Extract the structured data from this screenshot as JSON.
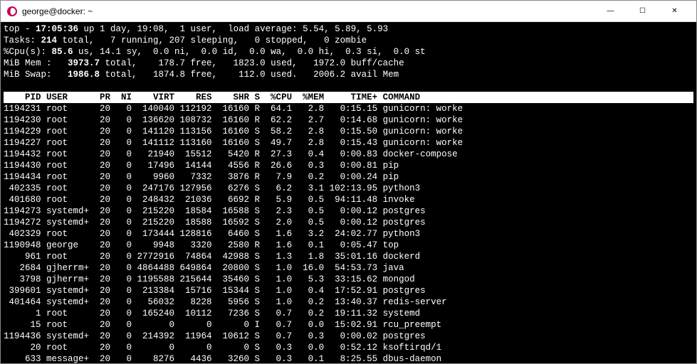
{
  "window": {
    "title": "george@docker: ~",
    "controls": {
      "min": "—",
      "max": "☐",
      "close": "✕"
    }
  },
  "summary": {
    "line1": "top - 17:05:36 up 1 day, 19:08,  1 user,  load average: 5.54, 5.89, 5.93",
    "line2": "Tasks: 214 total,   7 running, 207 sleeping,   0 stopped,   0 zombie",
    "line3": "%Cpu(s): 85.6 us, 14.1 sy,  0.0 ni,  0.0 id,  0.0 wa,  0.0 hi,  0.3 si,  0.0 st",
    "line4": "MiB Mem :   3973.7 total,    178.7 free,   1823.0 used,   1972.0 buff/cache",
    "line5": "MiB Swap:   1986.8 total,   1874.8 free,    112.0 used.   2006.2 avail Mem ",
    "tasks_total_bold": "214",
    "mem_total_bold": "3973.7",
    "swap_total_bold": "1986.8"
  },
  "header": "    PID USER      PR  NI    VIRT    RES    SHR S  %CPU  %MEM     TIME+ COMMAND",
  "processes": [
    {
      "pid": "1194231",
      "user": "root",
      "pr": "20",
      "ni": "0",
      "virt": "140040",
      "res": "112192",
      "shr": "16160",
      "s": "R",
      "cpu": "64.1",
      "mem": "2.8",
      "time": "0:15.15",
      "cmd": "gunicorn: worke"
    },
    {
      "pid": "1194230",
      "user": "root",
      "pr": "20",
      "ni": "0",
      "virt": "136620",
      "res": "108732",
      "shr": "16160",
      "s": "R",
      "cpu": "62.2",
      "mem": "2.7",
      "time": "0:14.68",
      "cmd": "gunicorn: worke"
    },
    {
      "pid": "1194229",
      "user": "root",
      "pr": "20",
      "ni": "0",
      "virt": "141120",
      "res": "113156",
      "shr": "16160",
      "s": "S",
      "cpu": "58.2",
      "mem": "2.8",
      "time": "0:15.50",
      "cmd": "gunicorn: worke"
    },
    {
      "pid": "1194227",
      "user": "root",
      "pr": "20",
      "ni": "0",
      "virt": "141112",
      "res": "113160",
      "shr": "16160",
      "s": "S",
      "cpu": "49.7",
      "mem": "2.8",
      "time": "0:15.43",
      "cmd": "gunicorn: worke"
    },
    {
      "pid": "1194432",
      "user": "root",
      "pr": "20",
      "ni": "0",
      "virt": "21940",
      "res": "15512",
      "shr": "5420",
      "s": "R",
      "cpu": "27.3",
      "mem": "0.4",
      "time": "0:00.83",
      "cmd": "docker-compose"
    },
    {
      "pid": "1194430",
      "user": "root",
      "pr": "20",
      "ni": "0",
      "virt": "17496",
      "res": "14144",
      "shr": "4556",
      "s": "R",
      "cpu": "26.6",
      "mem": "0.3",
      "time": "0:00.81",
      "cmd": "pip"
    },
    {
      "pid": "1194434",
      "user": "root",
      "pr": "20",
      "ni": "0",
      "virt": "9960",
      "res": "7332",
      "shr": "3876",
      "s": "R",
      "cpu": "7.9",
      "mem": "0.2",
      "time": "0:00.24",
      "cmd": "pip"
    },
    {
      "pid": "402335",
      "user": "root",
      "pr": "20",
      "ni": "0",
      "virt": "247176",
      "res": "127956",
      "shr": "6276",
      "s": "S",
      "cpu": "6.2",
      "mem": "3.1",
      "time": "102:13.95",
      "cmd": "python3"
    },
    {
      "pid": "401680",
      "user": "root",
      "pr": "20",
      "ni": "0",
      "virt": "248432",
      "res": "21036",
      "shr": "6692",
      "s": "R",
      "cpu": "5.9",
      "mem": "0.5",
      "time": "94:11.48",
      "cmd": "invoke"
    },
    {
      "pid": "1194273",
      "user": "systemd+",
      "pr": "20",
      "ni": "0",
      "virt": "215220",
      "res": "18584",
      "shr": "16588",
      "s": "S",
      "cpu": "2.3",
      "mem": "0.5",
      "time": "0:00.12",
      "cmd": "postgres"
    },
    {
      "pid": "1194272",
      "user": "systemd+",
      "pr": "20",
      "ni": "0",
      "virt": "215220",
      "res": "18588",
      "shr": "16592",
      "s": "S",
      "cpu": "2.0",
      "mem": "0.5",
      "time": "0:00.12",
      "cmd": "postgres"
    },
    {
      "pid": "402329",
      "user": "root",
      "pr": "20",
      "ni": "0",
      "virt": "173444",
      "res": "128816",
      "shr": "6460",
      "s": "S",
      "cpu": "1.6",
      "mem": "3.2",
      "time": "24:02.77",
      "cmd": "python3"
    },
    {
      "pid": "1190948",
      "user": "george",
      "pr": "20",
      "ni": "0",
      "virt": "9948",
      "res": "3320",
      "shr": "2580",
      "s": "R",
      "cpu": "1.6",
      "mem": "0.1",
      "time": "0:05.47",
      "cmd": "top"
    },
    {
      "pid": "961",
      "user": "root",
      "pr": "20",
      "ni": "0",
      "virt": "2772916",
      "res": "74864",
      "shr": "42988",
      "s": "S",
      "cpu": "1.3",
      "mem": "1.8",
      "time": "35:01.16",
      "cmd": "dockerd"
    },
    {
      "pid": "2684",
      "user": "gjherrm+",
      "pr": "20",
      "ni": "0",
      "virt": "4864488",
      "res": "649864",
      "shr": "20800",
      "s": "S",
      "cpu": "1.0",
      "mem": "16.0",
      "time": "54:53.73",
      "cmd": "java"
    },
    {
      "pid": "3798",
      "user": "gjherrm+",
      "pr": "20",
      "ni": "0",
      "virt": "1195588",
      "res": "215644",
      "shr": "35460",
      "s": "S",
      "cpu": "1.0",
      "mem": "5.3",
      "time": "33:15.62",
      "cmd": "mongod"
    },
    {
      "pid": "399601",
      "user": "systemd+",
      "pr": "20",
      "ni": "0",
      "virt": "213384",
      "res": "15716",
      "shr": "15344",
      "s": "S",
      "cpu": "1.0",
      "mem": "0.4",
      "time": "17:52.91",
      "cmd": "postgres"
    },
    {
      "pid": "401464",
      "user": "systemd+",
      "pr": "20",
      "ni": "0",
      "virt": "56032",
      "res": "8228",
      "shr": "5956",
      "s": "S",
      "cpu": "1.0",
      "mem": "0.2",
      "time": "13:40.37",
      "cmd": "redis-server"
    },
    {
      "pid": "1",
      "user": "root",
      "pr": "20",
      "ni": "0",
      "virt": "165240",
      "res": "10112",
      "shr": "7236",
      "s": "S",
      "cpu": "0.7",
      "mem": "0.2",
      "time": "19:11.32",
      "cmd": "systemd"
    },
    {
      "pid": "15",
      "user": "root",
      "pr": "20",
      "ni": "0",
      "virt": "0",
      "res": "0",
      "shr": "0",
      "s": "I",
      "cpu": "0.7",
      "mem": "0.0",
      "time": "15:02.91",
      "cmd": "rcu_preempt"
    },
    {
      "pid": "1194436",
      "user": "systemd+",
      "pr": "20",
      "ni": "0",
      "virt": "214392",
      "res": "11964",
      "shr": "10612",
      "s": "S",
      "cpu": "0.7",
      "mem": "0.3",
      "time": "0:00.02",
      "cmd": "postgres"
    },
    {
      "pid": "20",
      "user": "root",
      "pr": "20",
      "ni": "0",
      "virt": "0",
      "res": "0",
      "shr": "0",
      "s": "S",
      "cpu": "0.3",
      "mem": "0.0",
      "time": "0:52.12",
      "cmd": "ksoftirqd/1"
    },
    {
      "pid": "633",
      "user": "message+",
      "pr": "20",
      "ni": "0",
      "virt": "8276",
      "res": "4436",
      "shr": "3260",
      "s": "S",
      "cpu": "0.3",
      "mem": "0.1",
      "time": "8:25.55",
      "cmd": "dbus-daemon"
    }
  ]
}
